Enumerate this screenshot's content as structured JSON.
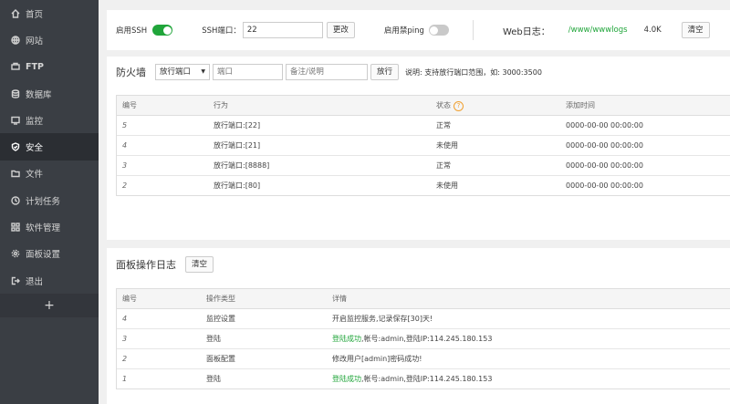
{
  "sidebar": {
    "items": [
      {
        "label": "首页",
        "icon": "home-icon"
      },
      {
        "label": "网站",
        "icon": "globe-icon"
      },
      {
        "label": "FTP",
        "icon": "ftp-icon"
      },
      {
        "label": "数据库",
        "icon": "database-icon"
      },
      {
        "label": "监控",
        "icon": "monitor-icon"
      },
      {
        "label": "安全",
        "icon": "shield-icon"
      },
      {
        "label": "文件",
        "icon": "folder-icon"
      },
      {
        "label": "计划任务",
        "icon": "clock-icon"
      },
      {
        "label": "软件管理",
        "icon": "grid-icon"
      },
      {
        "label": "面板设置",
        "icon": "gear-icon"
      },
      {
        "label": "退出",
        "icon": "logout-icon"
      }
    ],
    "add_label": "+",
    "active": "安全"
  },
  "ssh": {
    "enable_label": "启用SSH",
    "enabled": true,
    "port_label": "SSH端口：",
    "port_value": "22",
    "change_button": "更改",
    "ping_label": "启用禁ping",
    "ping_enabled": false,
    "weblog_label": "Web日志：",
    "weblog_path": "/www/wwwlogs",
    "weblog_size": "4.0K",
    "clear_button": "清空"
  },
  "firewall": {
    "title": "防火墙",
    "select_value": "放行端口",
    "port_placeholder": "端口",
    "remark_placeholder": "备注/说明",
    "allow_button": "放行",
    "hint": "说明: 支持放行端口范围，如: 3000:3500",
    "columns": [
      "编号",
      "行为",
      "状态",
      "添加时间"
    ],
    "rows": [
      {
        "id": "5",
        "action": "放行端口:[22]",
        "status": "正常",
        "time": "0000-00-00 00:00:00"
      },
      {
        "id": "4",
        "action": "放行端口:[21]",
        "status": "未使用",
        "time": "0000-00-00 00:00:00"
      },
      {
        "id": "3",
        "action": "放行端口:[8888]",
        "status": "正常",
        "time": "0000-00-00 00:00:00"
      },
      {
        "id": "2",
        "action": "放行端口:[80]",
        "status": "未使用",
        "time": "0000-00-00 00:00:00"
      }
    ]
  },
  "logs": {
    "title": "面板操作日志",
    "clear_button": "清空",
    "columns": [
      "编号",
      "操作类型",
      "详情"
    ],
    "rows": [
      {
        "id": "4",
        "type": "监控设置",
        "detail_prefix": "",
        "detail": "开启监控服务,记录保存[30]天!"
      },
      {
        "id": "3",
        "type": "登陆",
        "detail_prefix": "登陆成功",
        "detail": ",帐号:admin,登陆IP:114.245.180.153"
      },
      {
        "id": "2",
        "type": "面板配置",
        "detail_prefix": "",
        "detail": "修改用户[admin]密码成功!"
      },
      {
        "id": "1",
        "type": "登陆",
        "detail_prefix": "登陆成功",
        "detail": ",帐号:admin,登陆IP:114.245.180.153"
      }
    ]
  }
}
